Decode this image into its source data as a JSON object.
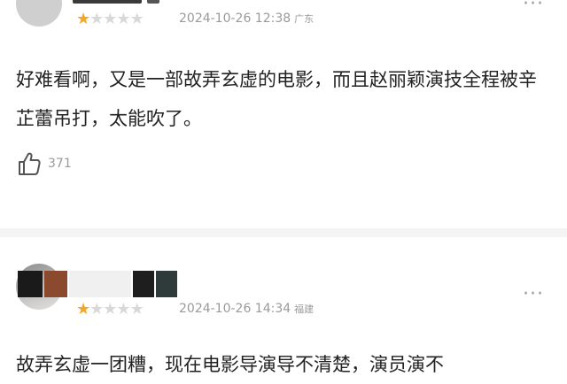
{
  "reviews": [
    {
      "rating_filled": 1,
      "rating_total": 5,
      "date": "2024-10-26 12:38",
      "location": "广东",
      "content": "好难看啊，又是一部故弄玄虚的电影，而且赵丽颖演技全程被辛芷蕾吊打，太能吹了。",
      "likes": "371"
    },
    {
      "rating_filled": 1,
      "rating_total": 5,
      "date": "2024-10-26 14:34",
      "location": "福建",
      "content": "故弄玄虚一团糟，现在电影导演导不清楚，演员演不"
    }
  ],
  "icons": {
    "star_filled": "★",
    "star_empty": "★",
    "more": "···",
    "like": "thumbs-up-icon"
  },
  "colors": {
    "star_active": "#f5a623",
    "star_inactive": "#d8d8d8",
    "meta_text": "#9a9a9a"
  }
}
